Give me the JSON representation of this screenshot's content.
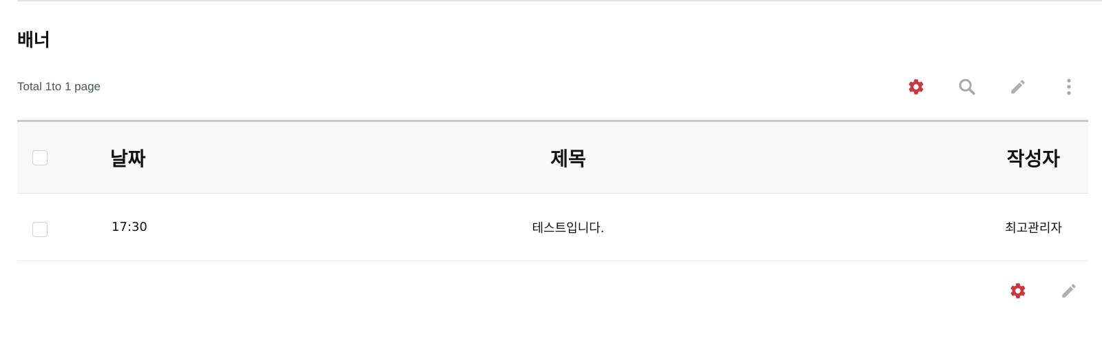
{
  "page": {
    "title": "배너",
    "total_text": "Total 1to 1 page"
  },
  "toolbar": {
    "icons": [
      "gear-icon",
      "search-icon",
      "pencil-icon",
      "more-vertical-icon"
    ]
  },
  "table": {
    "headers": {
      "date": "날짜",
      "title": "제목",
      "author": "작성자"
    },
    "rows": [
      {
        "date": "17:30",
        "title": "테스트입니다.",
        "author": "최고관리자",
        "checked": false
      }
    ]
  },
  "bottom_toolbar": {
    "icons": [
      "gear-icon",
      "pencil-icon"
    ]
  },
  "colors": {
    "accent_red": "#c9383f",
    "icon_gray": "#a8a8a8",
    "header_bg": "#f8f8f8"
  }
}
